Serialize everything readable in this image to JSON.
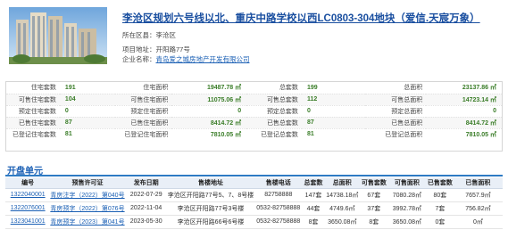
{
  "project": {
    "title": "李沧区规划六号线以北、重庆中路学校以西LC0803-304地块（爱信.天宸万象）",
    "district_label": "所在区县：",
    "district": "李沧区",
    "address_label": "项目地址：",
    "address": "开阳路77号",
    "company_label": "企业名称：",
    "company": "青岛爱之城房地产开发有限公司"
  },
  "stats_rows": [
    [
      "住宅套数",
      "191",
      "住宅面积",
      "19487.78 ㎡",
      "总套数",
      "199",
      "总面积",
      "23137.86 ㎡"
    ],
    [
      "可售住宅套数",
      "104",
      "可售住宅面积",
      "11075.06 ㎡",
      "可售总套数",
      "112",
      "可售总面积",
      "14723.14 ㎡"
    ],
    [
      "预定住宅套数",
      "0",
      "预定住宅面积",
      "0",
      "预定总套数",
      "0",
      "预定总面积",
      "0"
    ],
    [
      "已售住宅套数",
      "87",
      "已售住宅面积",
      "8414.72 ㎡",
      "已售总套数",
      "87",
      "已售总面积",
      "8414.72 ㎡"
    ],
    [
      "已登记住宅套数",
      "81",
      "已登记住宅面积",
      "7810.05 ㎡",
      "已登记总套数",
      "81",
      "已登记总面积",
      "7810.05 ㎡"
    ]
  ],
  "units_section_title": "开盘单元",
  "units_headers": [
    "编号",
    "预售许可证",
    "发布日期",
    "售楼地址",
    "售楼电话",
    "总套数",
    "总面积",
    "可售套数",
    "可售面积",
    "已售套数",
    "已售面积"
  ],
  "units_rows": [
    [
      "1322040001",
      "青房注字（2022）第040号",
      "2022-07-29",
      "李沧区开阳路77号5、7、8号楼",
      "82758888",
      "147套",
      "14738.18㎡",
      "67套",
      "7080.28㎡",
      "80套",
      "7657.9㎡"
    ],
    [
      "1322076001",
      "青房预字（2022）第076号",
      "2022-11-04",
      "李沧区开阳路77号3号楼",
      "0532-82758888",
      "44套",
      "4749.6㎡",
      "37套",
      "3992.78㎡",
      "7套",
      "756.82㎡"
    ],
    [
      "1323041001",
      "青房预字（2023）第041号",
      "2023-05-30",
      "李沧区开阳路66号6号楼",
      "0532-82758888",
      "8套",
      "3650.08㎡",
      "8套",
      "3650.08㎡",
      "0套",
      "0㎡"
    ]
  ],
  "colors": {
    "link": "#1a5fb4",
    "title": "#1a4fa0",
    "number": "#3a7d28",
    "section_line": "#2e7bc4"
  },
  "icons": [
    "building-photo"
  ]
}
